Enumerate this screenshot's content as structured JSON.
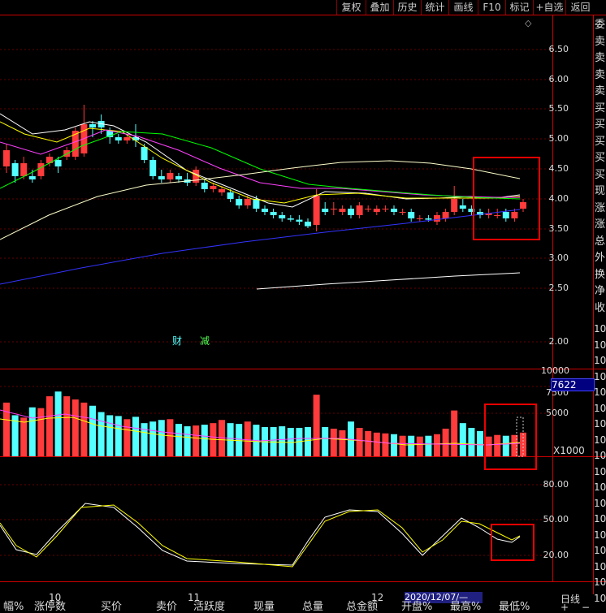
{
  "toolbar": [
    "复权",
    "叠加",
    "历史",
    "统计",
    "画线",
    "F10",
    "标记",
    "+自选",
    "返回"
  ],
  "diamond_icon": "◇",
  "price_axis": [
    "6.50",
    "6.00",
    "5.50",
    "5.00",
    "4.50",
    "4.00",
    "3.50",
    "3.00",
    "2.50",
    "2.00"
  ],
  "volume_axis": [
    "10000",
    "7500",
    "5000"
  ],
  "volume_readout": "7622",
  "volume_unit": "X1000",
  "indicator_axis": [
    "80.00",
    "50.00",
    "20.00"
  ],
  "badges": {
    "cai": "财",
    "jian": "减"
  },
  "date_axis": [
    "10",
    "11",
    "12"
  ],
  "date_cursor": "2020/12/07/—",
  "period": "日线",
  "plus": "+",
  "minus": "−",
  "side_labels": [
    "委",
    "卖",
    "卖",
    "卖",
    "卖",
    "买",
    "买",
    "买",
    "买",
    "买",
    "现",
    "涨",
    "涨",
    "总",
    "外",
    "换",
    "净",
    "收"
  ],
  "side_values": [
    "10",
    "10",
    "10",
    "10",
    "10",
    "10",
    "10",
    "10",
    "10",
    "10",
    "10",
    "10",
    "10",
    "10",
    "10",
    "10",
    "10",
    "10"
  ],
  "bottom_columns": [
    "幅%",
    "涨停数",
    "买价",
    "卖价",
    "活跃度",
    "现量",
    "总量",
    "总金额",
    "开盘%",
    "最高%",
    "最低%"
  ],
  "colors": {
    "up": "#ff3b3b",
    "down": "#54ffff",
    "ma5": "#ffffff",
    "ma10": "#ffff00",
    "ma20": "#ff40ff",
    "ma30": "#00ff00",
    "ma60": "#ffffcc",
    "ma120": "#3333ff",
    "grid": "#cc0000",
    "highlight": "#e00000"
  }
}
